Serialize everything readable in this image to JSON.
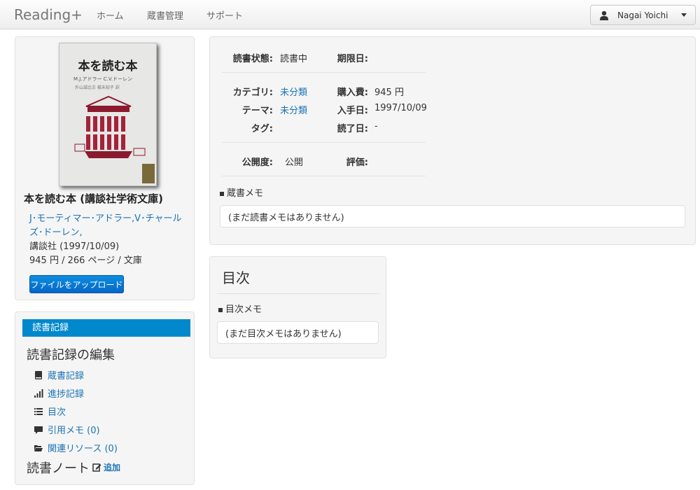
{
  "navbar": {
    "brand": "Reading+",
    "items": [
      "ホーム",
      "蔵書管理",
      "サポート"
    ],
    "user_name": "Nagai Yoichi"
  },
  "book": {
    "cover": {
      "title": "本を読む本",
      "authors": "M.J.アドラー C.V.ドーレン",
      "translators": "外山滋比古 槇未知子 訳"
    },
    "title": "本を読む本 (講談社学術文庫)",
    "authors": "J･モーティマー･アドラー,V･チャールズ･ドーレン,",
    "publisher_date": "講談社 (1997/10/09)",
    "spec": "945 円 / 266 ページ / 文庫",
    "upload_button": "ファイルをアップロード"
  },
  "record": {
    "header": "読書記録",
    "edit_title": "読書記録の編集",
    "items": [
      {
        "label": "蔵書記録",
        "icon": "book-icon"
      },
      {
        "label": "進捗記録",
        "icon": "signal-icon"
      },
      {
        "label": "目次",
        "icon": "list-icon"
      },
      {
        "label": "引用メモ (0)",
        "icon": "comment-icon"
      },
      {
        "label": "関連リソース (0)",
        "icon": "folder-open-icon"
      }
    ],
    "note_title": "読書ノート",
    "note_add": "追加"
  },
  "status": {
    "reading_label": "読書状態:",
    "reading_value": "読書中",
    "due_label": "期限日:",
    "due_value": "",
    "category_label": "カテゴリ:",
    "category_value": "未分類",
    "price_label": "購入費:",
    "price_value": "945 円",
    "theme_label": "テーマ:",
    "theme_value": "未分類",
    "acquired_label": "入手日:",
    "acquired_value": "1997/10/09",
    "tag_label": "タグ:",
    "tag_value": "",
    "finished_label": "読了日:",
    "finished_value": "-",
    "visibility_label": "公開度:",
    "visibility_value": "公開",
    "rating_label": "評価:",
    "rating_value": "",
    "memo_title": "蔵書メモ",
    "memo_text": "(まだ読書メモはありません)"
  },
  "toc": {
    "title": "目次",
    "memo_title": "目次メモ",
    "memo_text": "(まだ目次メモはありません)"
  },
  "colors": {
    "accent": "#0088cc",
    "link": "#1a73b5",
    "button": "#0567c8"
  }
}
